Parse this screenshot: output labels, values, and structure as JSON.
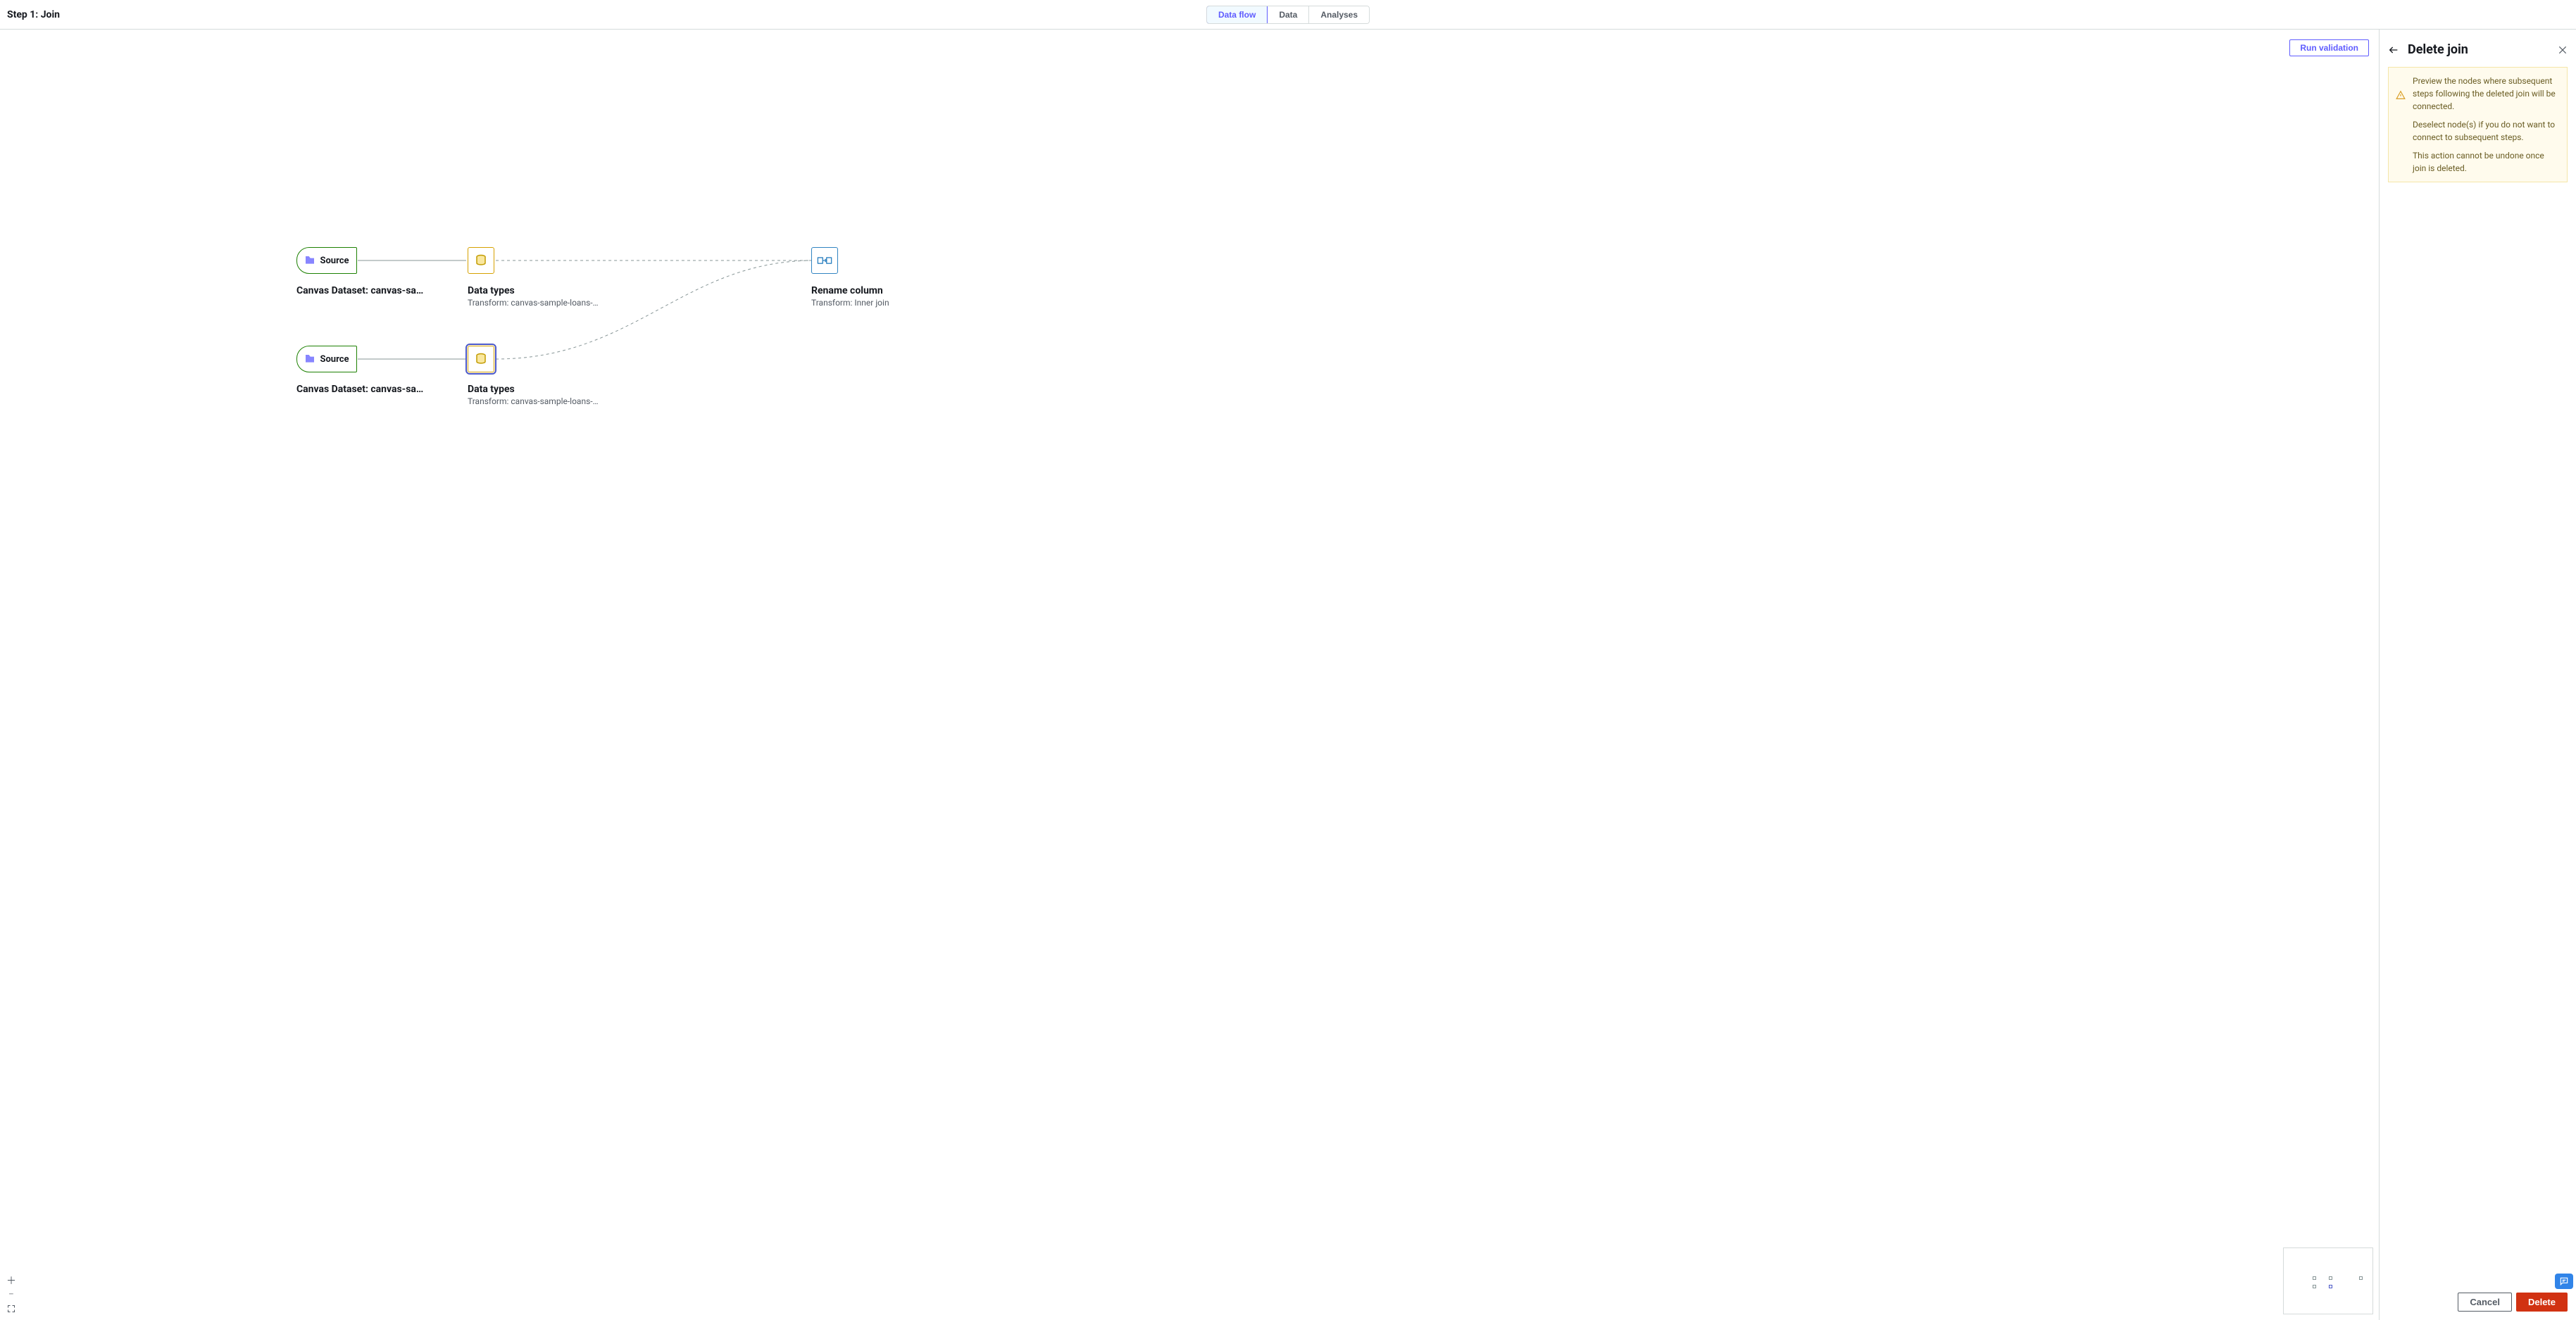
{
  "header": {
    "title": "Step 1: Join",
    "tabs": [
      "Data flow",
      "Data",
      "Analyses"
    ]
  },
  "actions": {
    "run_validation": "Run validation"
  },
  "panel": {
    "title": "Delete join",
    "warning_line1": "Preview the nodes where subsequent steps following the deleted join will be connected.",
    "warning_line2": "Deselect node(s) if you do not want to connect to subsequent steps.",
    "warning_line3": "This action cannot be undone once join is deleted.",
    "cancel": "Cancel",
    "delete": "Delete"
  },
  "nodes": {
    "source1": {
      "label": "Source",
      "title": "Canvas Dataset: canvas-sample-…"
    },
    "datatypes1": {
      "title": "Data types",
      "sub": "Transform: canvas-sample-loans-part-…"
    },
    "source2": {
      "label": "Source",
      "title": "Canvas Dataset: canvas-sample-…"
    },
    "datatypes2": {
      "title": "Data types",
      "sub": "Transform: canvas-sample-loans-part-…"
    },
    "rename": {
      "title": "Rename column",
      "sub": "Transform: Inner join"
    }
  }
}
